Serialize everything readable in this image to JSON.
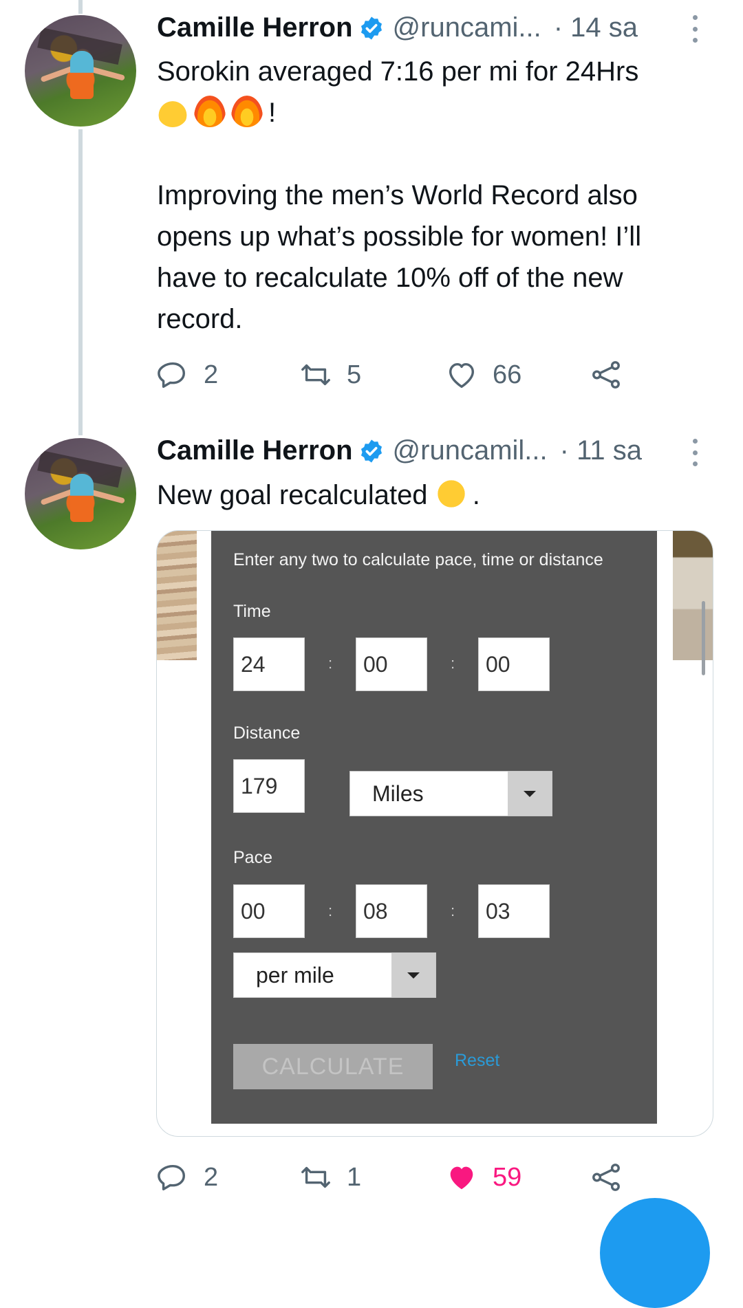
{
  "tweets": [
    {
      "author": "Camille Herron",
      "handle": "@runcami...",
      "time": "· 14 sa",
      "text_line1": "Sorokin averaged 7:16 per mi for 24Hrs",
      "emoji_suffix": "!",
      "emojis": [
        "exploding-head-emoji",
        "fire-emoji",
        "fire-emoji"
      ],
      "text_paragraph2": "Improving the men’s World Record also opens up what’s possible for women! I’ll have to recalculate 10% off of the new record.",
      "replies": "2",
      "retweets": "5",
      "likes": "66",
      "liked": false
    },
    {
      "author": "Camille Herron",
      "handle": "@runcamil...",
      "time": "· 11 sa",
      "text": "New goal recalculated",
      "text_suffix": ".",
      "emojis": [
        "thinking-face-emoji"
      ],
      "replies": "2",
      "retweets": "1",
      "likes": "59",
      "liked": true
    }
  ],
  "calculator": {
    "prompt": "Enter any two to calculate pace, time or distance",
    "time_label": "Time",
    "time": {
      "hours": "24",
      "minutes": "00",
      "seconds": "00"
    },
    "distance_label": "Distance",
    "distance": "179",
    "distance_unit": "Miles",
    "pace_label": "Pace",
    "pace": {
      "hours": "00",
      "minutes": "08",
      "seconds": "03"
    },
    "pace_unit": "per mile",
    "colon": ":",
    "calculate_label": "CALCULATE",
    "reset_label": "Reset"
  },
  "colors": {
    "accent": "#1d9bf0",
    "like_active": "#f91880",
    "muted": "#536471",
    "calculator_bg": "#555555",
    "reset_link": "#2a9bd8"
  }
}
